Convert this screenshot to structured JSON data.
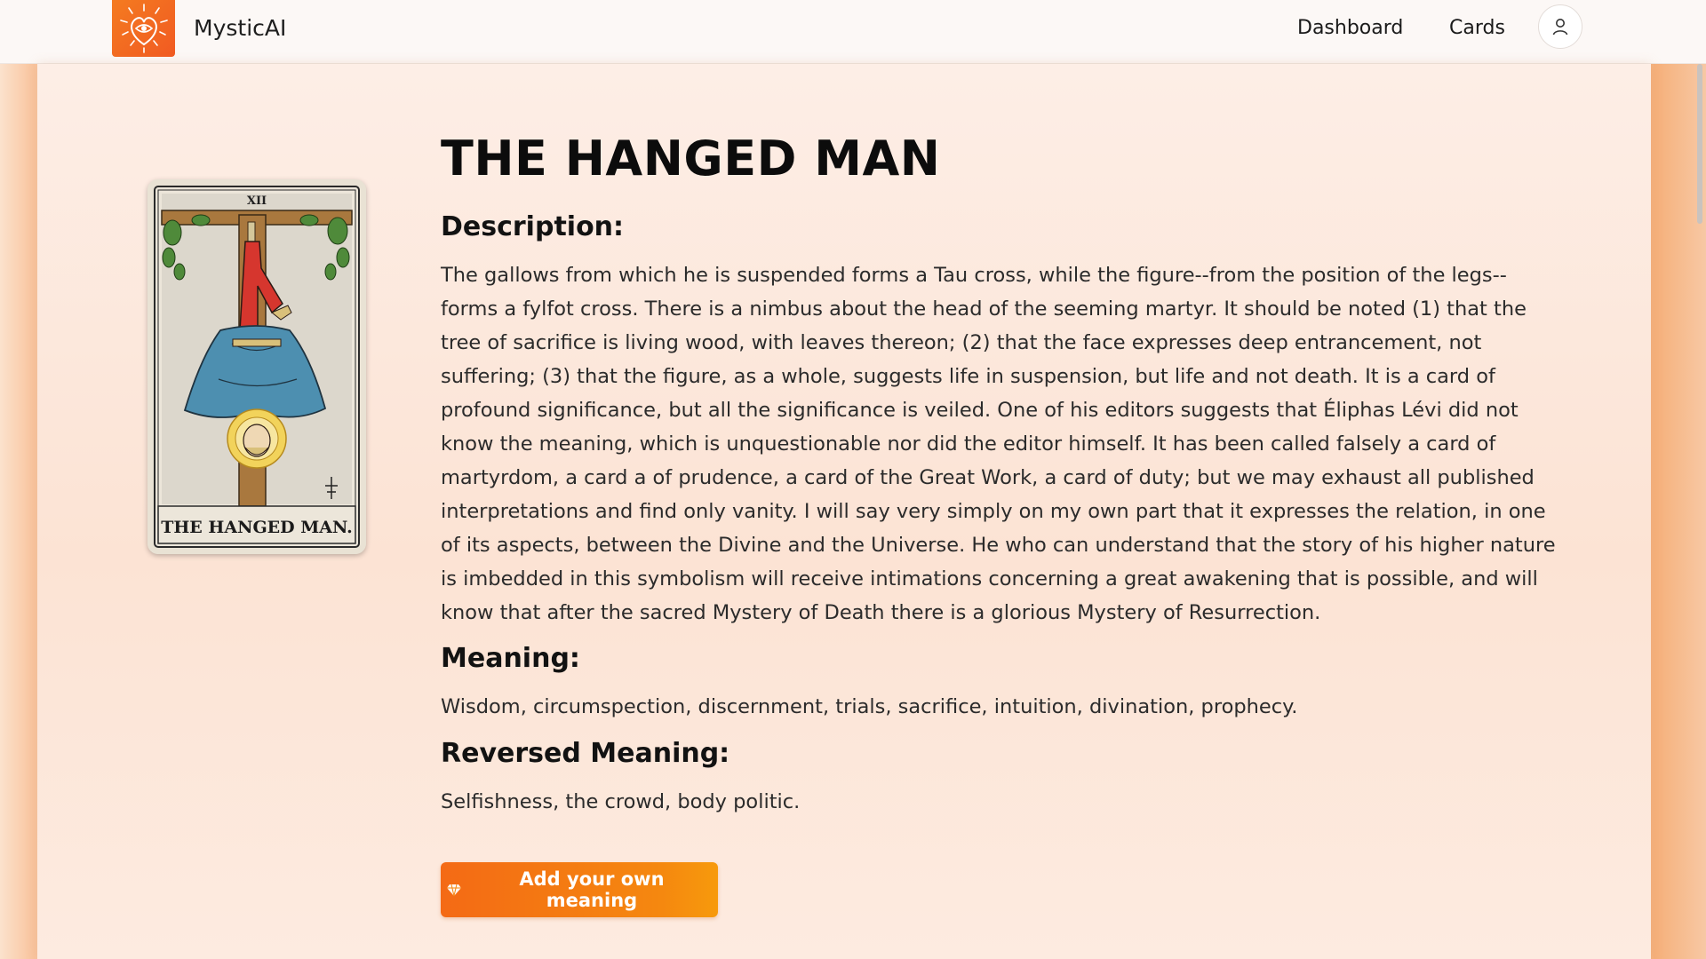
{
  "app": {
    "brand": "MysticAI"
  },
  "nav": {
    "dashboard_label": "Dashboard",
    "cards_label": "Cards"
  },
  "card": {
    "image_numeral": "XII",
    "image_caption": "THE HANGED MAN.",
    "title": "THE HANGED MAN",
    "description_heading": "Description:",
    "description": "The gallows from which he is suspended forms a Tau cross, while the figure--from the position of the legs--forms a fylfot cross. There is a nimbus about the head of the seeming martyr. It should be noted (1) that the tree of sacrifice is living wood, with leaves thereon; (2) that the face expresses deep entrancement, not suffering; (3) that the figure, as a whole, suggests life in suspension, but life and not death. It is a card of profound significance, but all the significance is veiled. One of his editors suggests that Éliphas Lévi did not know the meaning, which is unquestionable nor did the editor himself. It has been called falsely a card of martyrdom, a card a of prudence, a card of the Great Work, a card of duty; but we may exhaust all published interpretations and find only vanity. I will say very simply on my own part that it expresses the relation, in one of its aspects, between the Divine and the Universe. He who can understand that the story of his higher nature is imbedded in this symbolism will receive intimations concerning a great awakening that is possible, and will know that after the sacred Mystery of Death there is a glorious Mystery of Resurrection.",
    "meaning_heading": "Meaning:",
    "meaning": "Wisdom, circumspection, discernment, trials, sacrifice, intuition, divination, prophecy.",
    "reversed_heading": "Reversed Meaning:",
    "reversed": "Selfishness, the crowd, body politic."
  },
  "actions": {
    "add_meaning_label": "Add your own meaning"
  },
  "icons": {
    "logo": "heart-eye-logo-icon",
    "user": "user-icon",
    "button": "gem-icon"
  },
  "colors": {
    "accent": "#f46a15",
    "logo_bg": "#f15a22",
    "background": "#fde9dc"
  }
}
